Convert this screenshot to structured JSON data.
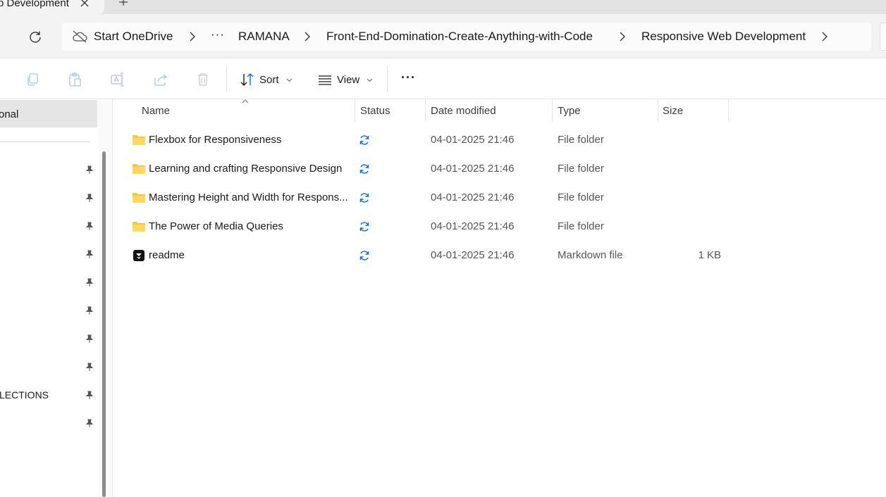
{
  "tab": {
    "title": "b Development",
    "close_icon": "close-icon",
    "new_tab_icon": "plus-icon"
  },
  "address": {
    "cloud_label": "Start OneDrive",
    "ellipsis": "···",
    "crumbs": [
      "RAMANA",
      "Front-End-Domination-Create-Anything-with-Code",
      "Responsive Web Development"
    ]
  },
  "toolbar": {
    "sort_label": "Sort",
    "view_label": "View",
    "more_label": "···"
  },
  "sidebar": {
    "selected_label": "onal",
    "collections_label": "LECTIONS"
  },
  "columns": {
    "name": "Name",
    "status": "Status",
    "date": "Date modified",
    "type": "Type",
    "size": "Size"
  },
  "files": [
    {
      "name": "Flexbox for Responsiveness",
      "date": "04-01-2025 21:46",
      "type": "File folder",
      "size": "",
      "icon": "folder-icon"
    },
    {
      "name": "Learning and crafting Responsive Design",
      "date": "04-01-2025 21:46",
      "type": "File folder",
      "size": "",
      "icon": "folder-icon"
    },
    {
      "name": "Mastering Height and Width for Respons...",
      "date": "04-01-2025 21:46",
      "type": "File folder",
      "size": "",
      "icon": "folder-icon"
    },
    {
      "name": "The Power of Media Queries",
      "date": "04-01-2025 21:46",
      "type": "File folder",
      "size": "",
      "icon": "folder-icon"
    },
    {
      "name": "readme",
      "date": "04-01-2025 21:46",
      "type": "Markdown file",
      "size": "1 KB",
      "icon": "markdown-file-icon"
    }
  ],
  "colors": {
    "sync_blue": "#0a6ed1",
    "folder_yellow": "#f8c73c",
    "selected_bg": "#e5e5e5"
  }
}
